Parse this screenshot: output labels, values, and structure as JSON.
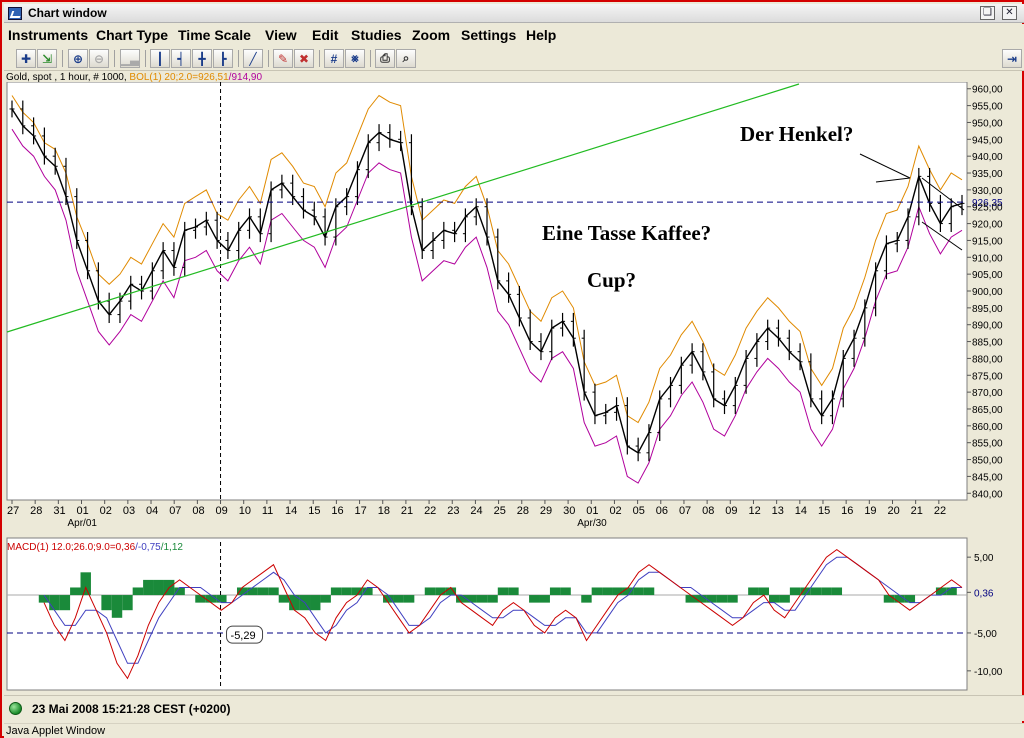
{
  "window": {
    "title": "Chart window",
    "restore_icon": "restore-icon",
    "close_icon": "close-icon"
  },
  "menu": {
    "items": [
      "Instruments",
      "Chart Type",
      "Time Scale",
      "View",
      "Edit",
      "Studies",
      "Zoom",
      "Settings",
      "Help"
    ]
  },
  "toolbar": {
    "icons": [
      "crosshair-icon",
      "move-icon",
      "zoom-in-icon",
      "zoom-out-icon",
      "bar-chart-icon",
      "candles-1-icon",
      "candles-2-icon",
      "candles-3-icon",
      "candles-4-icon",
      "line-tool-icon",
      "eraser-icon",
      "delete-icon",
      "grid-icon",
      "remove-grid-icon",
      "print-icon",
      "print-preview-icon",
      "pin-icon"
    ]
  },
  "chart_info": {
    "instrument": "Gold, spot , 1 hour, # 1000,",
    "bollinger_label": "BOL(1) 20;2.0=",
    "bollinger_upper": "926,51",
    "bollinger_sep": "/",
    "bollinger_lower": "914,90"
  },
  "colors": {
    "price": "#000000",
    "bollinger_upper": "#e08a00",
    "bollinger_lower": "#b0009c",
    "trendline": "#22bb22",
    "current_price_line": "#000080",
    "macd": "#cc0000",
    "signal": "#4040c0",
    "histogram": "#1a8a3a",
    "frame": "#d40000"
  },
  "chart_data": [
    {
      "type": "candlestick",
      "y_ticks": [
        "960,00",
        "955,00",
        "950,00",
        "945,00",
        "940,00",
        "935,00",
        "930,00",
        "925,00",
        "920,00",
        "915,00",
        "910,00",
        "905,00",
        "900,00",
        "895,00",
        "890,00",
        "885,00",
        "880,00",
        "875,00",
        "870,00",
        "865,00",
        "860,00",
        "855,00",
        "850,00",
        "845,00",
        "840,00"
      ],
      "ylim": [
        838,
        962
      ],
      "current_price": "926,35",
      "x_ticks": [
        "27",
        "28",
        "31",
        "01",
        "02",
        "03",
        "04",
        "07",
        "08",
        "09",
        "10",
        "11",
        "14",
        "15",
        "16",
        "17",
        "18",
        "21",
        "22",
        "23",
        "24",
        "25",
        "28",
        "29",
        "30",
        "01",
        "02",
        "05",
        "06",
        "07",
        "08",
        "09",
        "12",
        "13",
        "14",
        "15",
        "16",
        "19",
        "20",
        "21",
        "22"
      ],
      "x_sublabels": [
        "Apr/01",
        "Apr/30"
      ],
      "annotations": [
        "Der Henkel?",
        "Eine Tasse Kaffee?",
        "Cup?"
      ],
      "series": [
        {
          "name": "Gold, spot",
          "values": [
            954,
            949,
            946,
            940,
            937,
            928,
            915,
            906,
            897,
            893,
            897,
            902,
            900,
            906,
            912,
            907,
            918,
            919,
            921,
            915,
            912,
            918,
            922,
            917,
            930,
            932,
            928,
            924,
            922,
            916,
            925,
            928,
            936,
            944,
            947,
            945,
            944,
            925,
            912,
            915,
            918,
            917,
            922,
            925,
            916,
            903,
            899,
            892,
            885,
            882,
            889,
            891,
            886,
            870,
            863,
            864,
            866,
            854,
            852,
            858,
            868,
            872,
            878,
            882,
            876,
            868,
            866,
            872,
            880,
            885,
            889,
            886,
            882,
            879,
            868,
            863,
            868,
            880,
            886,
            895,
            906,
            914,
            915,
            922,
            934,
            926,
            920,
            925,
            926
          ]
        },
        {
          "name": "BOL upper",
          "values": [
            958,
            953,
            950,
            944,
            942,
            935,
            922,
            914,
            905,
            902,
            905,
            910,
            908,
            914,
            920,
            916,
            926,
            928,
            930,
            923,
            921,
            927,
            931,
            926,
            939,
            941,
            937,
            932,
            931,
            925,
            935,
            938,
            946,
            954,
            958,
            956,
            955,
            934,
            921,
            924,
            927,
            926,
            931,
            934,
            925,
            912,
            908,
            901,
            894,
            891,
            898,
            900,
            895,
            879,
            872,
            873,
            875,
            863,
            861,
            867,
            877,
            881,
            887,
            891,
            885,
            877,
            875,
            881,
            889,
            894,
            898,
            895,
            891,
            888,
            877,
            872,
            877,
            889,
            895,
            904,
            915,
            923,
            924,
            931,
            943,
            936,
            930,
            935,
            933
          ]
        },
        {
          "name": "BOL lower",
          "values": [
            948,
            943,
            940,
            934,
            930,
            921,
            906,
            897,
            888,
            884,
            888,
            893,
            891,
            897,
            903,
            898,
            909,
            910,
            912,
            906,
            903,
            909,
            913,
            908,
            921,
            923,
            919,
            915,
            913,
            907,
            916,
            919,
            927,
            935,
            938,
            936,
            935,
            916,
            903,
            906,
            909,
            908,
            913,
            916,
            907,
            894,
            890,
            883,
            876,
            873,
            880,
            882,
            877,
            861,
            854,
            855,
            857,
            845,
            843,
            849,
            859,
            863,
            869,
            873,
            867,
            859,
            857,
            863,
            871,
            876,
            880,
            877,
            873,
            870,
            859,
            854,
            859,
            871,
            877,
            886,
            897,
            905,
            906,
            913,
            925,
            917,
            911,
            916,
            918
          ]
        }
      ]
    },
    {
      "type": "line",
      "title": "MACD(1) 12.0;26.0;9.0=",
      "title_value_1": "0,36",
      "title_value_2": "/-0,75",
      "title_value_3": "/1,12",
      "y_ticks": [
        "5,00",
        "0,36",
        "-5,00",
        "-10,00"
      ],
      "ylim": [
        -12,
        7
      ],
      "marker_label": "-5,29",
      "series": [
        {
          "name": "MACD",
          "values": [
            -1,
            -4,
            -6,
            -3,
            1,
            -2,
            -5,
            -9,
            -11,
            -8,
            -4,
            -1,
            1,
            2,
            1,
            0,
            -1,
            -2,
            -1,
            1,
            2,
            3,
            4,
            1,
            -2,
            -3,
            -5,
            -6,
            -3,
            -1,
            0,
            2,
            1,
            -1,
            -3,
            -5,
            -4,
            -2,
            0,
            1,
            -1,
            -2,
            -3,
            -4,
            -2,
            -1,
            -2,
            -4,
            -5,
            -3,
            -2,
            -3,
            -6,
            -4,
            -2,
            0,
            1,
            3,
            4,
            3,
            2,
            1,
            0,
            -1,
            -2,
            -3,
            -4,
            -3,
            -1,
            0,
            -2,
            -3,
            -1,
            1,
            3,
            5,
            6,
            5,
            4,
            3,
            2,
            0,
            -1,
            -2,
            -1,
            0,
            1,
            2,
            1
          ]
        },
        {
          "name": "Signal",
          "values": [
            0,
            -2,
            -4,
            -4,
            -2,
            -2,
            -3,
            -6,
            -9,
            -9,
            -6,
            -3,
            -1,
            1,
            1,
            1,
            0,
            -1,
            -1,
            0,
            1,
            2,
            3,
            2,
            0,
            -1,
            -3,
            -5,
            -4,
            -2,
            -1,
            1,
            1,
            0,
            -2,
            -4,
            -4,
            -3,
            -1,
            0,
            0,
            -1,
            -2,
            -3,
            -3,
            -2,
            -2,
            -3,
            -4,
            -4,
            -3,
            -3,
            -5,
            -5,
            -3,
            -1,
            0,
            2,
            3,
            3,
            2,
            1,
            1,
            0,
            -1,
            -2,
            -3,
            -3,
            -2,
            -1,
            -1,
            -2,
            -2,
            0,
            2,
            4,
            5,
            5,
            4,
            3,
            2,
            1,
            0,
            -1,
            -1,
            0,
            0,
            1,
            1
          ]
        }
      ]
    }
  ],
  "status": {
    "datetime": "23 Mai 2008 15:21:28  CEST (+0200)"
  },
  "footer": {
    "text": "Java Applet Window"
  }
}
